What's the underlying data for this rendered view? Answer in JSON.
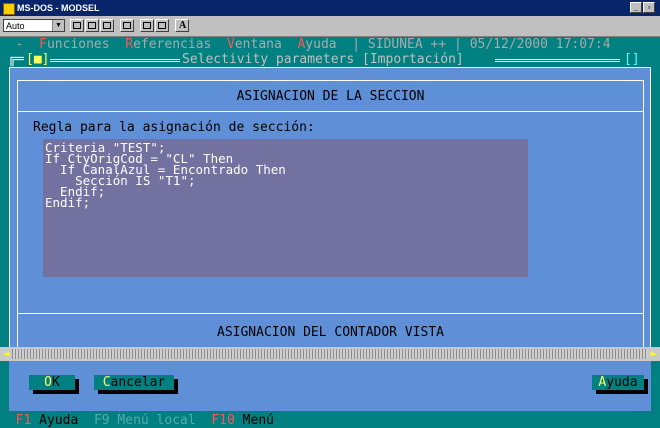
{
  "window": {
    "title": "MS-DOS - MODSEL",
    "font_size_select": "Auto"
  },
  "menubar": {
    "system": "-",
    "items": [
      {
        "hotkey": "F",
        "rest": "unciones"
      },
      {
        "hotkey": "R",
        "rest": "eferencias"
      },
      {
        "hotkey": "V",
        "rest": "entana"
      },
      {
        "hotkey": "A",
        "rest": "yuda"
      }
    ],
    "app_name": "SIDUNEA ++",
    "datetime": "05/12/2000 17:07:4"
  },
  "frame": {
    "close": "[■]",
    "title": "Selectivity parameters [Importación]",
    "zoom": "[]"
  },
  "section_header": "ASIGNACION DE LA SECCION",
  "rule_label": "Regla para la asignación de sección:",
  "code_lines": [
    "Criteria \"TEST\";",
    "If CtyOrigCod = \"CL\" Then",
    "  If CanalAzul = Encontrado Then",
    "    Sección IS \"T1\";",
    "  Endif;",
    "Endif;"
  ],
  "counter_header": "ASIGNACION DEL CONTADOR VISTA",
  "buttons": {
    "ok": {
      "hotkey": "O",
      "rest": "K"
    },
    "cancel": {
      "hotkey": "C",
      "rest": "ancelar"
    },
    "help": {
      "hotkey": "A",
      "rest": "yuda"
    }
  },
  "statusbar": [
    {
      "key": "F1",
      "label": "Ayuda",
      "enabled": true
    },
    {
      "key": "F9",
      "label": "Menú local",
      "enabled": false
    },
    {
      "key": "F10",
      "label": "Menú",
      "enabled": true
    }
  ],
  "colors": {
    "desktop": "#008080",
    "window": "#5f8fd7",
    "editor": "#7371a0",
    "hotkey": "#ff5555",
    "button_hotkey": "#ffff55"
  }
}
